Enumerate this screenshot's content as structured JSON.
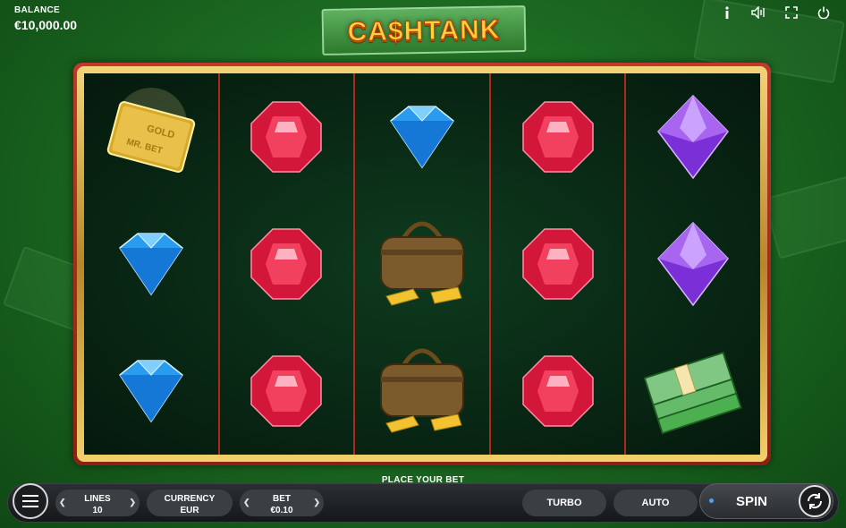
{
  "balance": {
    "label": "BALANCE",
    "value": "€10,000.00"
  },
  "logo": {
    "text": "CA$HTANK"
  },
  "top_icons": [
    "info-icon",
    "sound-icon",
    "fullscreen-icon",
    "power-icon"
  ],
  "reels": [
    [
      "gold-card",
      "blue-diamond",
      "blue-diamond"
    ],
    [
      "red-ruby",
      "red-ruby",
      "red-ruby"
    ],
    [
      "blue-diamond",
      "money-bag",
      "money-bag"
    ],
    [
      "red-ruby",
      "red-ruby",
      "red-ruby"
    ],
    [
      "purple-gem",
      "purple-gem",
      "cash-stack"
    ]
  ],
  "gold_card": {
    "line1": "GOLD",
    "line2": "MR. BET"
  },
  "place_bet": "PLACE YOUR BET",
  "controls": {
    "lines": {
      "label": "LINES",
      "value": "10"
    },
    "currency": {
      "label": "CURRENCY",
      "value": "EUR"
    },
    "bet": {
      "label": "BET",
      "value": "€0.10"
    },
    "turbo": "TURBO",
    "auto": "AUTO",
    "spin": "SPIN"
  },
  "colors": {
    "frame_red": "#c0392b",
    "frame_gold": "#e9c063",
    "background_green": "#1c6b22"
  }
}
